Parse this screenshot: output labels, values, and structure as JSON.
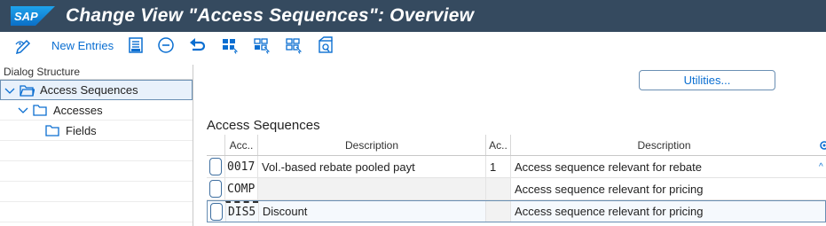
{
  "window": {
    "title": "Change View \"Access Sequences\": Overview",
    "logo_text": "SAP"
  },
  "toolbar": {
    "new_entries_label": "New Entries",
    "icons": [
      "edit-display-icon",
      "new-entries-icon",
      "copy-as-icon",
      "delete-icon",
      "undo-icon",
      "select-all-icon",
      "select-block-icon",
      "deselect-all-icon",
      "configure-icon"
    ]
  },
  "dialog_structure": {
    "header": "Dialog Structure",
    "items": [
      {
        "label": "Access Sequences",
        "level": 0,
        "expanded": true,
        "selected": true
      },
      {
        "label": "Accesses",
        "level": 1,
        "expanded": true,
        "selected": false
      },
      {
        "label": "Fields",
        "level": 2,
        "expanded": false,
        "selected": false
      }
    ]
  },
  "main": {
    "utilities_label": "Utilities...",
    "section_title": "Access Sequences",
    "columns": [
      "Acc..",
      "Description",
      "Ac..",
      "Description"
    ],
    "rows": [
      {
        "acc": "0017",
        "description": "Vol.-based rebate pooled payt",
        "ac": "1",
        "description2": "Access sequence relevant for rebate"
      },
      {
        "acc": "COMP",
        "description": "",
        "ac": "",
        "description2": "Access sequence relevant for pricing"
      },
      {
        "acc": "DIS5",
        "description": "Discount",
        "ac": "",
        "description2": "Access sequence relevant for pricing"
      }
    ]
  },
  "colors": {
    "titlebar": "#354a5f",
    "accent": "#0a6ed1",
    "selection_border": "#6a8fb3"
  }
}
